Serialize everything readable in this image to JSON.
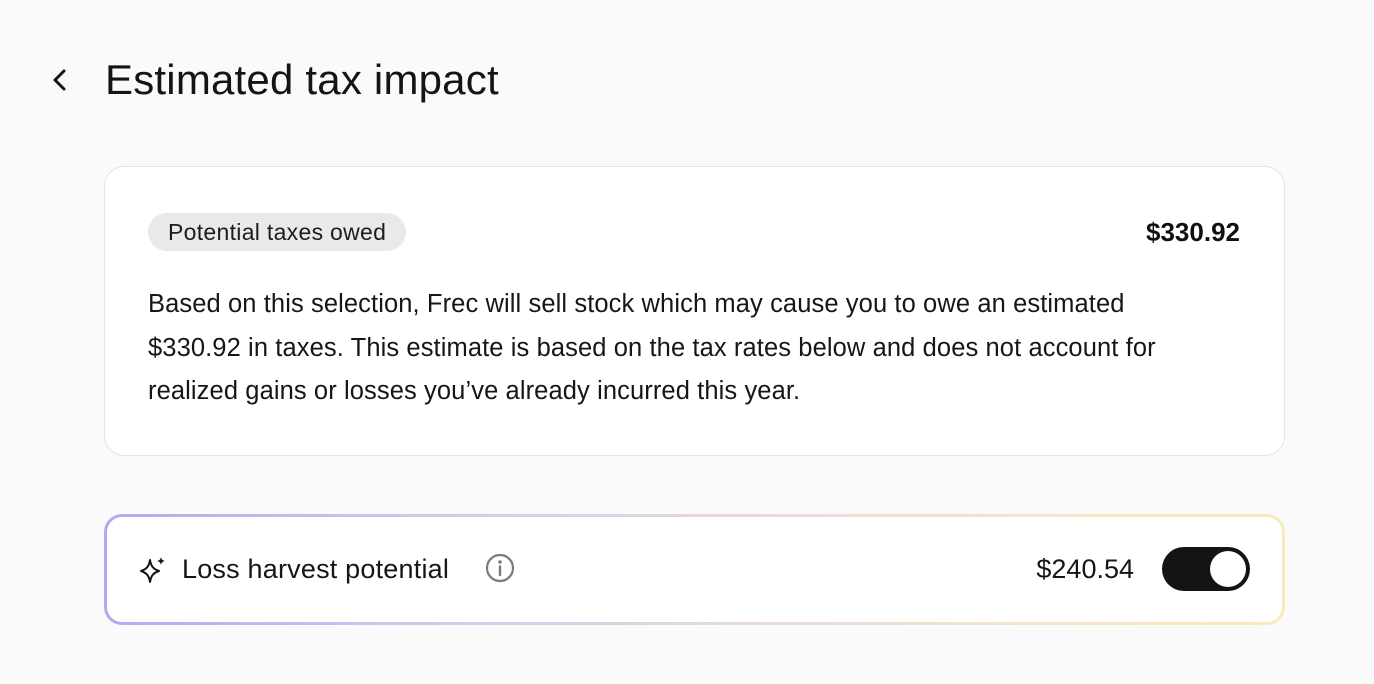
{
  "header": {
    "title": "Estimated tax impact",
    "back_icon": "chevron-left-icon"
  },
  "tax_card": {
    "pill_label": "Potential taxes owed",
    "amount": "$330.92",
    "description": "Based on this selection, Frec will sell stock which may cause you to owe an estimated $330.92 in taxes. This estimate is based on the tax rates below and does not account for realized gains or losses you’ve already incurred this year."
  },
  "harvest": {
    "icon": "sparkle-icon",
    "label": "Loss harvest potential",
    "info_icon": "info-icon",
    "amount": "$240.54",
    "toggle_on": true
  },
  "colors": {
    "background": "#fafafa",
    "card": "#ffffff",
    "pill": "#e9e9e9",
    "toggle": "#141414",
    "gradient_start": "#b8a6f0",
    "gradient_end": "#f9eab8"
  }
}
